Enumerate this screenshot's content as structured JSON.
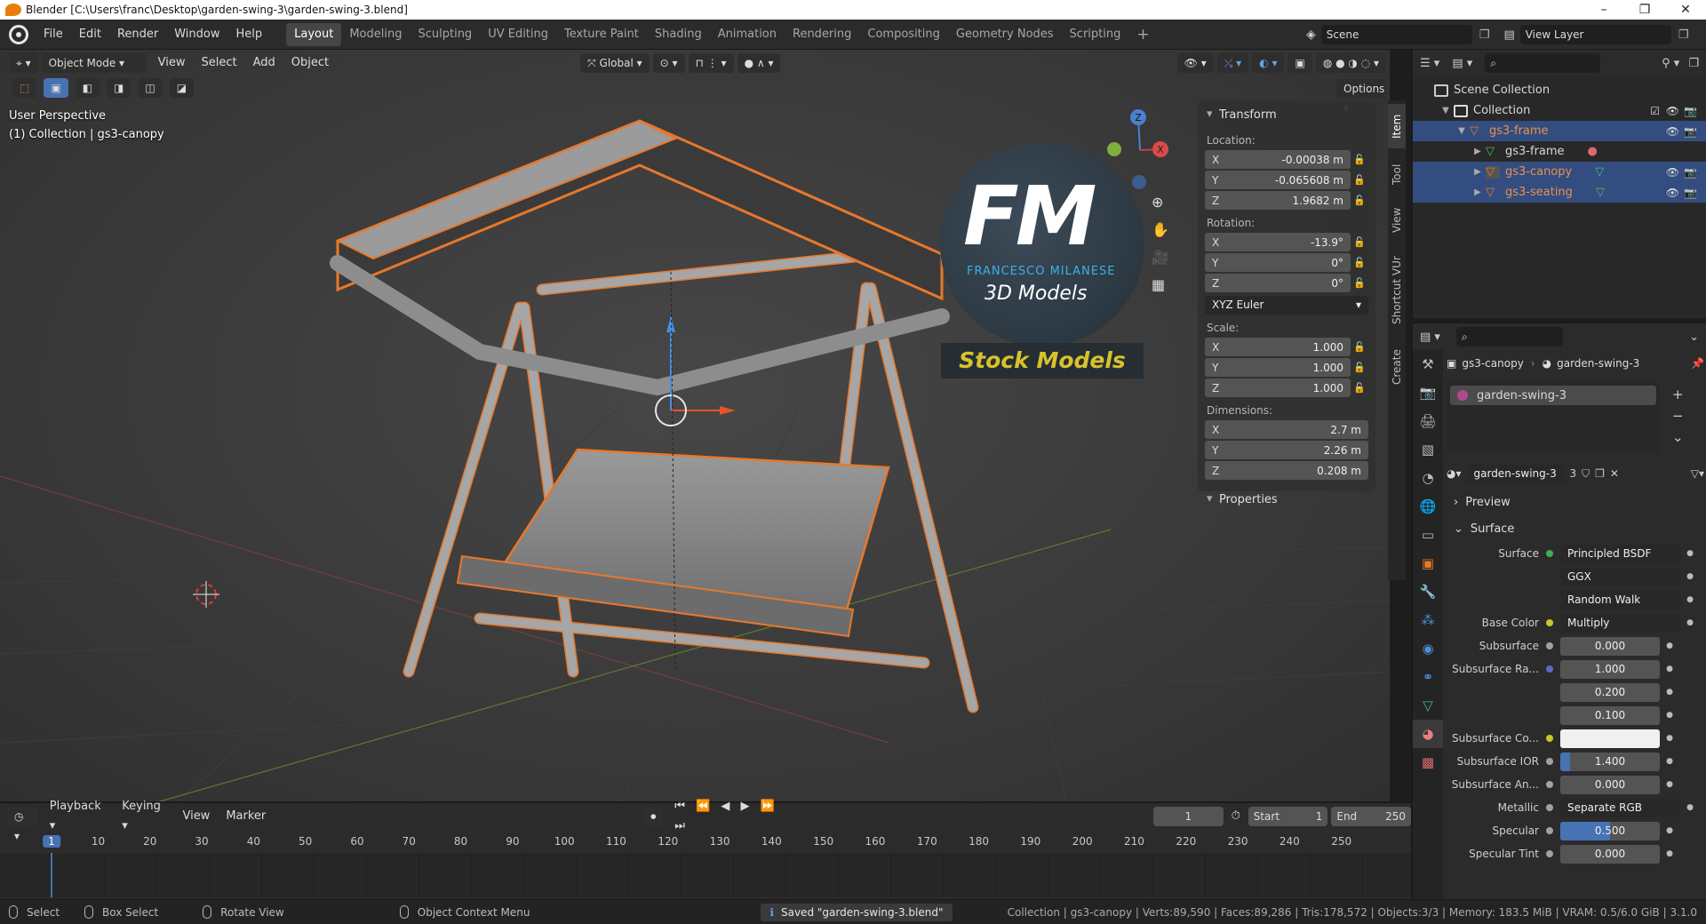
{
  "window": {
    "title": "Blender [C:\\Users\\franc\\Desktop\\garden-swing-3\\garden-swing-3.blend]"
  },
  "menu": [
    "File",
    "Edit",
    "Render",
    "Window",
    "Help"
  ],
  "workspaces": [
    "Layout",
    "Modeling",
    "Sculpting",
    "UV Editing",
    "Texture Paint",
    "Shading",
    "Animation",
    "Rendering",
    "Compositing",
    "Geometry Nodes",
    "Scripting"
  ],
  "active_workspace": "Layout",
  "scene": {
    "label": "Scene",
    "view_layer": "View Layer"
  },
  "viewport": {
    "mode": "Object Mode",
    "menus": [
      "View",
      "Select",
      "Add",
      "Object"
    ],
    "orientation": "Global",
    "options_label": "Options",
    "perspective": "User Perspective",
    "context": "(1) Collection | gs3-canopy",
    "axes": {
      "x": "X",
      "y": "Y",
      "z": "Z"
    }
  },
  "watermark": {
    "logo": "FM",
    "name": "FRANCESCO MILANESE",
    "sub": "3D Models",
    "badge": "Stock Models"
  },
  "npanel": {
    "transform_title": "Transform",
    "location_label": "Location:",
    "location": [
      {
        "axis": "X",
        "value": "-0.00038 m"
      },
      {
        "axis": "Y",
        "value": "-0.065608 m"
      },
      {
        "axis": "Z",
        "value": "1.9682 m"
      }
    ],
    "rotation_label": "Rotation:",
    "rotation": [
      {
        "axis": "X",
        "value": "-13.9°"
      },
      {
        "axis": "Y",
        "value": "0°"
      },
      {
        "axis": "Z",
        "value": "0°"
      }
    ],
    "rotation_mode": "XYZ Euler",
    "scale_label": "Scale:",
    "scale": [
      {
        "axis": "X",
        "value": "1.000"
      },
      {
        "axis": "Y",
        "value": "1.000"
      },
      {
        "axis": "Z",
        "value": "1.000"
      }
    ],
    "dimensions_label": "Dimensions:",
    "dimensions": [
      {
        "axis": "X",
        "value": "2.7 m"
      },
      {
        "axis": "Y",
        "value": "2.26 m"
      },
      {
        "axis": "Z",
        "value": "0.208 m"
      }
    ],
    "properties_title": "Properties",
    "tabs": [
      "Item",
      "Tool",
      "View",
      "Shortcut VUr",
      "Create"
    ]
  },
  "outliner": {
    "items": [
      {
        "label": "Scene Collection",
        "indent": 0
      },
      {
        "label": "Collection",
        "indent": 1
      },
      {
        "label": "gs3-frame",
        "indent": 2,
        "selected": true,
        "orange": true
      },
      {
        "label": "gs3-frame",
        "indent": 3
      },
      {
        "label": "gs3-canopy",
        "indent": 3,
        "selected": true,
        "orange": true
      },
      {
        "label": "gs3-seating",
        "indent": 3,
        "selected": true,
        "orange": true
      }
    ]
  },
  "properties": {
    "breadcrumb_object": "gs3-canopy",
    "breadcrumb_material": "garden-swing-3",
    "material_slot": "garden-swing-3",
    "material_name": "garden-swing-3",
    "user_count": "3",
    "preview_label": "Preview",
    "surface_section": "Surface",
    "rows": [
      {
        "label": "Surface",
        "kind": "drop",
        "value": "Principled BSDF",
        "dot": "#3fae57"
      },
      {
        "label": "",
        "kind": "drop",
        "value": "GGX"
      },
      {
        "label": "",
        "kind": "drop",
        "value": "Random Walk"
      },
      {
        "label": "Base Color",
        "kind": "drop",
        "value": "Multiply",
        "dot": "#c7c729",
        "arrow": true
      },
      {
        "label": "Subsurface",
        "kind": "field",
        "value": "0.000",
        "dot": "#a1a1a1",
        "fill": 0
      },
      {
        "label": "Subsurface Ra...",
        "kind": "field",
        "value": "1.000",
        "dot": "#6363c7"
      },
      {
        "label": "",
        "kind": "field",
        "value": "0.200"
      },
      {
        "label": "",
        "kind": "field",
        "value": "0.100"
      },
      {
        "label": "Subsurface Co...",
        "kind": "swatch",
        "value": "",
        "dot": "#c7c729"
      },
      {
        "label": "Subsurface IOR",
        "kind": "field",
        "value": "1.400",
        "dot": "#a1a1a1",
        "fill": 0.1
      },
      {
        "label": "Subsurface An...",
        "kind": "field",
        "value": "0.000",
        "dot": "#a1a1a1"
      },
      {
        "label": "Metallic",
        "kind": "drop",
        "value": "Separate RGB",
        "dot": "#a1a1a1",
        "arrow": true
      },
      {
        "label": "Specular",
        "kind": "field",
        "value": "0.500",
        "dot": "#a1a1a1",
        "fill": 0.5
      },
      {
        "label": "Specular Tint",
        "kind": "field",
        "value": "0.000",
        "dot": "#a1a1a1"
      }
    ]
  },
  "timeline": {
    "menus": [
      "Playback",
      "Keying",
      "View",
      "Marker"
    ],
    "current_frame": "1",
    "start_label": "Start",
    "start": "1",
    "end_label": "End",
    "end": "250",
    "ticks": [
      "1",
      "10",
      "20",
      "30",
      "40",
      "50",
      "60",
      "70",
      "80",
      "90",
      "100",
      "110",
      "120",
      "130",
      "140",
      "150",
      "160",
      "170",
      "180",
      "190",
      "200",
      "210",
      "220",
      "230",
      "240",
      "250"
    ]
  },
  "status": {
    "select": "Select",
    "box_select": "Box Select",
    "rotate": "Rotate View",
    "context_menu": "Object Context Menu",
    "message": "Saved \"garden-swing-3.blend\"",
    "stats": "Collection | gs3-canopy | Verts:89,590 | Faces:89,286 | Tris:178,572 | Objects:3/3 | Memory: 183.5 MiB | VRAM: 0.5/6.0 GiB | 3.1.0"
  }
}
